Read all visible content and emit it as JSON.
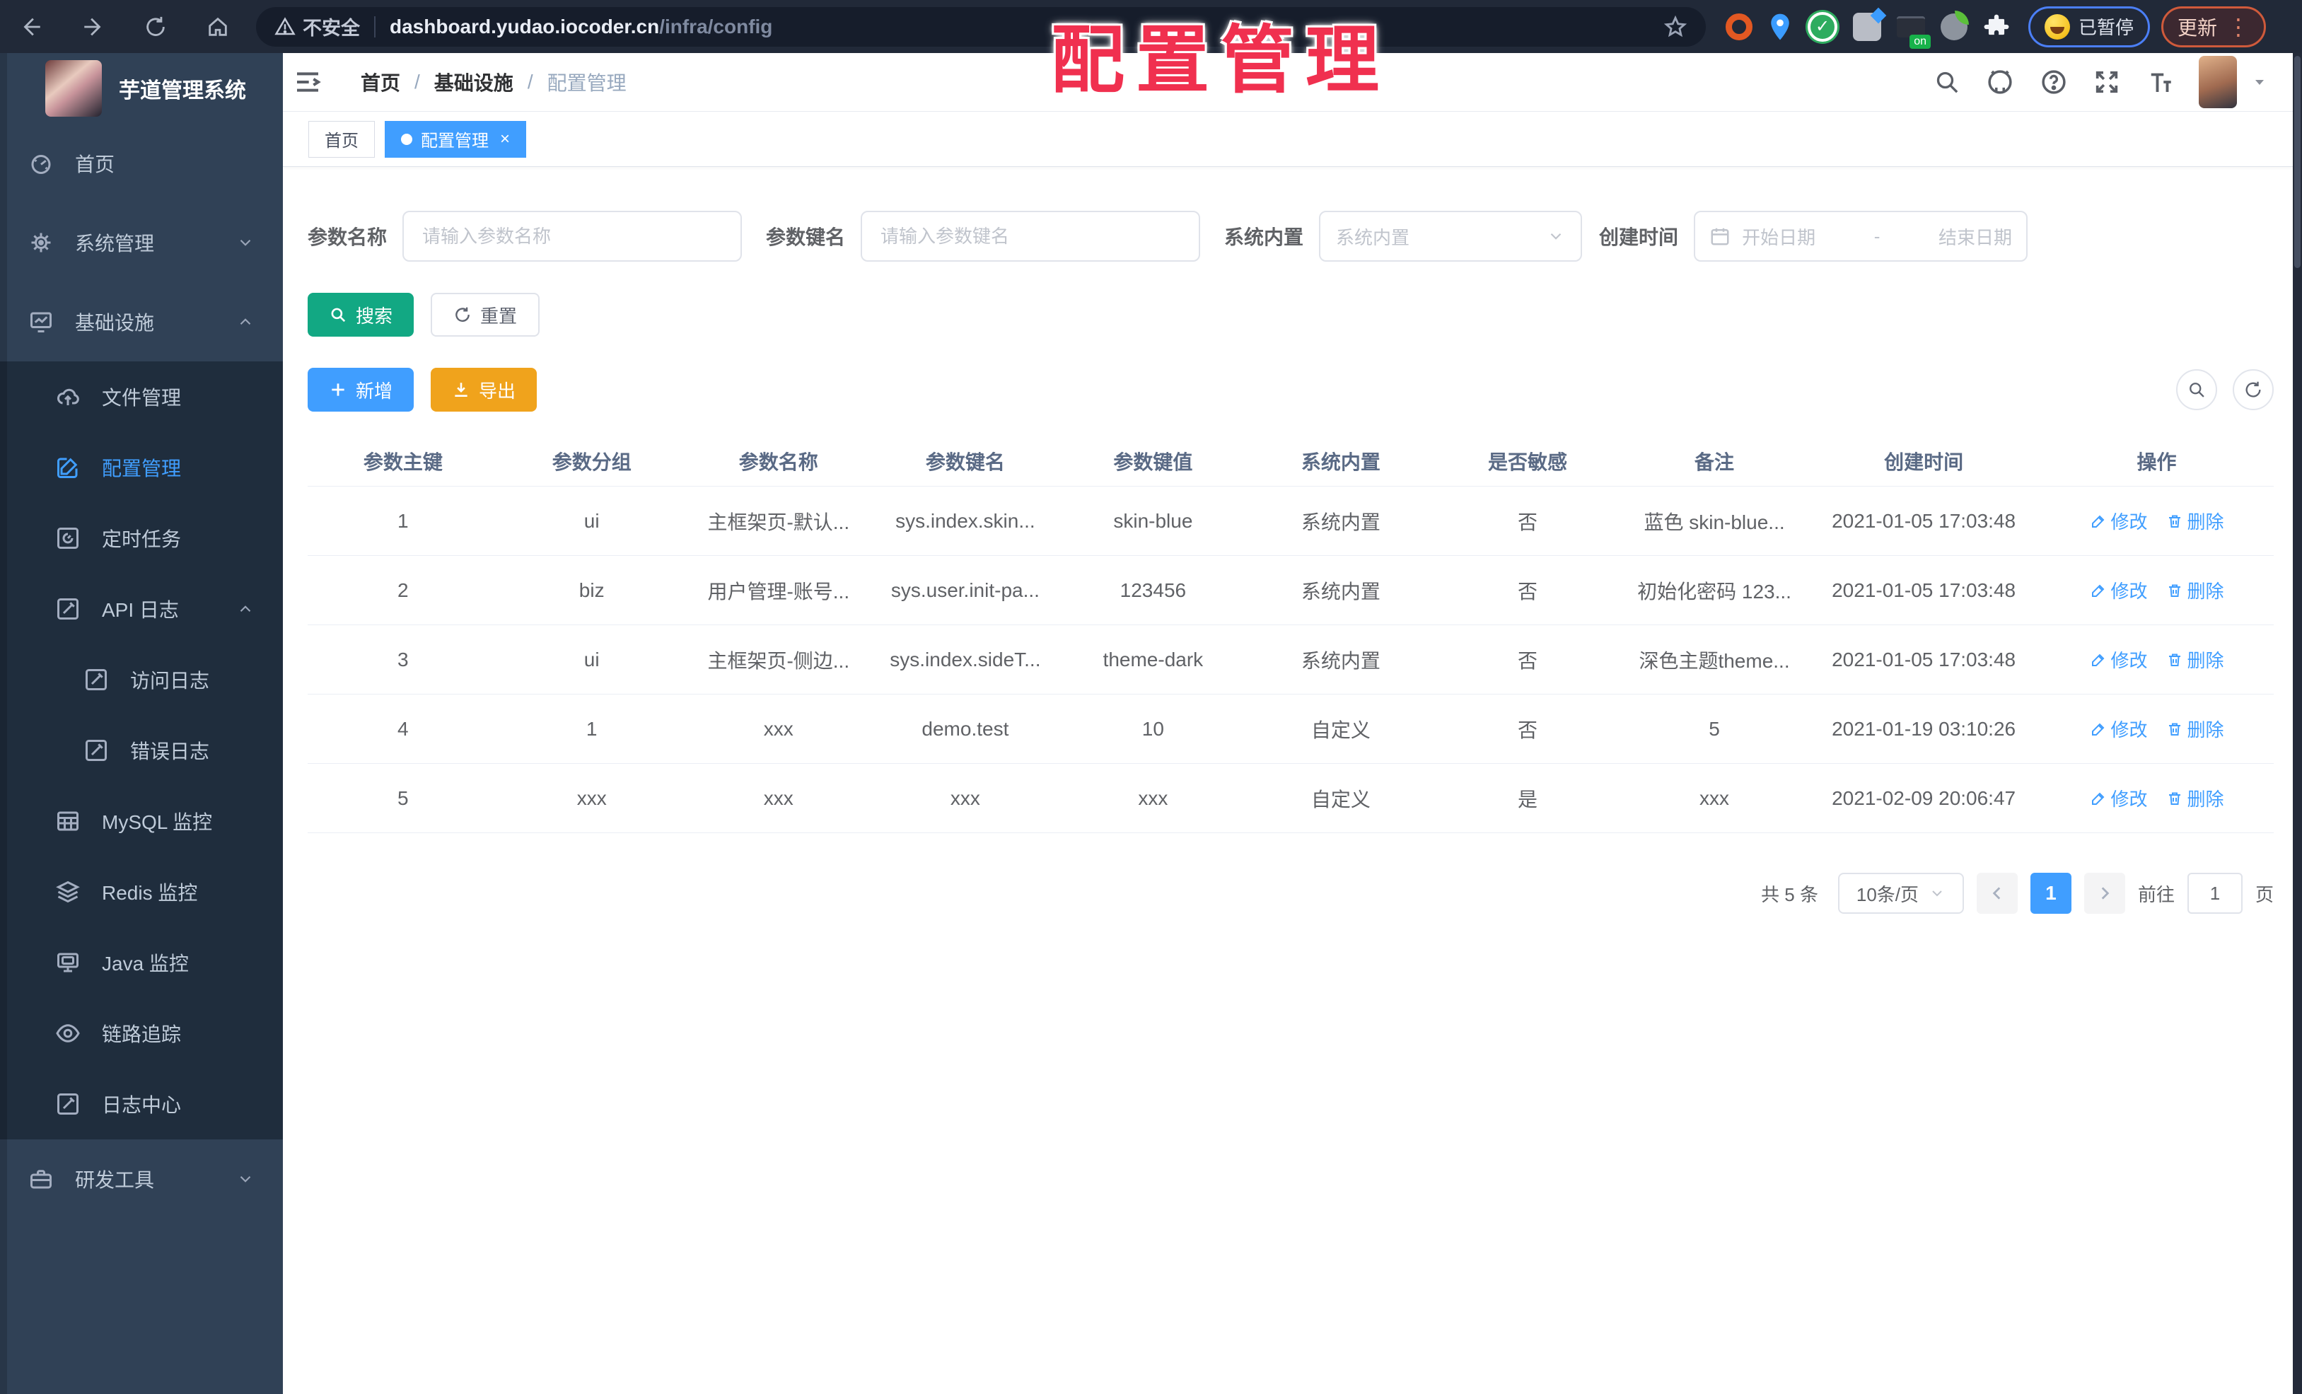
{
  "browser": {
    "security_label": "不安全",
    "url_host": "dashboard.yudao.iocoder.cn",
    "url_path": "/infra/config",
    "paused_badge": "已暂停",
    "update_label": "更新"
  },
  "overlay_title": "配置管理",
  "sidebar": {
    "logo_title": "芋道管理系统",
    "items": [
      {
        "label": "首页"
      },
      {
        "label": "系统管理"
      },
      {
        "label": "基础设施"
      },
      {
        "label": "文件管理"
      },
      {
        "label": "配置管理"
      },
      {
        "label": "定时任务"
      },
      {
        "label": "API 日志"
      },
      {
        "label": "访问日志"
      },
      {
        "label": "错误日志"
      },
      {
        "label": "MySQL 监控"
      },
      {
        "label": "Redis 监控"
      },
      {
        "label": "Java 监控"
      },
      {
        "label": "链路追踪"
      },
      {
        "label": "日志中心"
      },
      {
        "label": "研发工具"
      }
    ]
  },
  "header": {
    "breadcrumb": [
      "首页",
      "基础设施",
      "配置管理"
    ]
  },
  "tabs": [
    {
      "label": "首页"
    },
    {
      "label": "配置管理"
    }
  ],
  "filters": {
    "name_label": "参数名称",
    "name_placeholder": "请输入参数名称",
    "key_label": "参数键名",
    "key_placeholder": "请输入参数键名",
    "type_label": "系统内置",
    "type_placeholder": "系统内置",
    "date_label": "创建时间",
    "date_start": "开始日期",
    "date_sep": "-",
    "date_end": "结束日期"
  },
  "buttons": {
    "search": "搜索",
    "reset": "重置",
    "add": "新增",
    "export": "导出"
  },
  "table": {
    "columns": [
      "参数主键",
      "参数分组",
      "参数名称",
      "参数键名",
      "参数键值",
      "系统内置",
      "是否敏感",
      "备注",
      "创建时间",
      "操作"
    ],
    "edit_label": "修改",
    "delete_label": "删除",
    "rows": [
      {
        "cells": [
          "1",
          "ui",
          "主框架页-默认...",
          "sys.index.skin...",
          "skin-blue",
          "系统内置",
          "否",
          "蓝色 skin-blue...",
          "2021-01-05 17:03:48"
        ]
      },
      {
        "cells": [
          "2",
          "biz",
          "用户管理-账号...",
          "sys.user.init-pa...",
          "123456",
          "系统内置",
          "否",
          "初始化密码 123...",
          "2021-01-05 17:03:48"
        ]
      },
      {
        "cells": [
          "3",
          "ui",
          "主框架页-侧边...",
          "sys.index.sideT...",
          "theme-dark",
          "系统内置",
          "否",
          "深色主题theme...",
          "2021-01-05 17:03:48"
        ]
      },
      {
        "cells": [
          "4",
          "1",
          "xxx",
          "demo.test",
          "10",
          "自定义",
          "否",
          "5",
          "2021-01-19 03:10:26"
        ]
      },
      {
        "cells": [
          "5",
          "xxx",
          "xxx",
          "xxx",
          "xxx",
          "自定义",
          "是",
          "xxx",
          "2021-02-09 20:06:47"
        ]
      }
    ]
  },
  "pagination": {
    "total": "共 5 条",
    "page_size": "10条/页",
    "current": "1",
    "goto_label": "前往",
    "goto_value": "1",
    "page_label": "页"
  },
  "colors": {
    "primary": "#409eff",
    "search_button": "#12a883",
    "export_button": "#f0a31c",
    "sidebar_bg": "#304156",
    "submenu_bg": "#1f2d3d",
    "overlay_title": "#f0304f"
  },
  "icons": {
    "browser": [
      "back",
      "forward",
      "refresh",
      "home",
      "warning",
      "star",
      "extensions",
      "kebab-menu"
    ],
    "topbar": [
      "search",
      "github",
      "docs-question",
      "fullscreen",
      "font-size",
      "avatar",
      "caret-down"
    ],
    "toolbar": [
      "search-toggle",
      "refresh"
    ]
  }
}
